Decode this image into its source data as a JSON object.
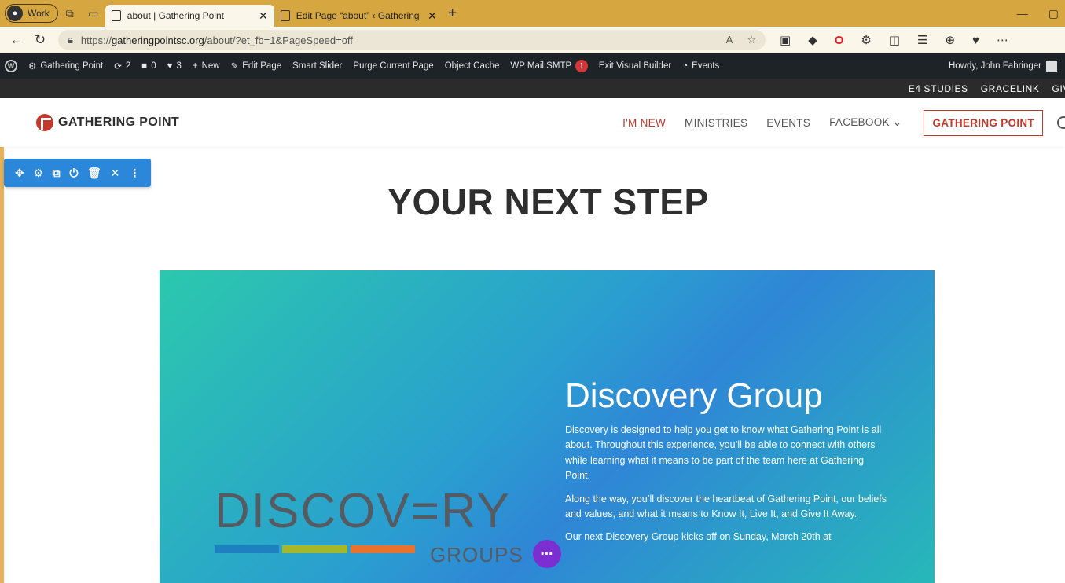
{
  "browser": {
    "profile_label": "Work",
    "tabs": [
      {
        "title": "about | Gathering Point",
        "active": true
      },
      {
        "title": "Edit Page “about” ‹ Gathering Po",
        "active": false
      }
    ],
    "new_tab": "+",
    "url_prefix": "https://",
    "url_domain": "gatheringpointsc.org",
    "url_path": "/about/?et_fb=1&PageSpeed=off"
  },
  "wp_admin": {
    "site_name": "Gathering Point",
    "updates_count": "2",
    "comments_count": "0",
    "likes_count": "3",
    "new_label": "New",
    "edit_page_label": "Edit Page",
    "smart_slider_label": "Smart Slider",
    "purge_label": "Purge Current Page",
    "object_cache_label": "Object Cache",
    "wp_mail_label": "WP Mail SMTP",
    "wp_mail_badge": "1",
    "exit_builder_label": "Exit Visual Builder",
    "events_label": "Events",
    "greeting": "Howdy, John Fahringer"
  },
  "secondary_nav": [
    "E4 STUDIES",
    "GRACELINK",
    "GIV"
  ],
  "site": {
    "logo_text": "GATHERING POINT",
    "nav": [
      "I'M NEW",
      "MINISTRIES",
      "EVENTS",
      "FACEBOOK"
    ],
    "cta_label": "GATHERING POINT"
  },
  "page": {
    "headline": "YOUR NEXT STEP",
    "discovery": {
      "logo_word": "DISCOV=RY",
      "logo_sub": "GROUPS",
      "title": "Discovery Group",
      "paragraphs": [
        "Discovery is designed to help you get to know what Gathering Point is all about. Throughout this experience, you’ll be able to connect with others while learning what it means to be part of the team here at Gathering Point.",
        "Along the way, you’ll discover the heartbeat of Gathering Point, our beliefs and values, and what it means to Know It, Live It, and Give It Away.",
        "Our next Discovery Group kicks off on Sunday, March 20th at"
      ]
    }
  },
  "colors": {
    "accent_red": "#c0392b",
    "divi_blue": "#2b87da",
    "fab_purple": "#7b2fd1"
  }
}
